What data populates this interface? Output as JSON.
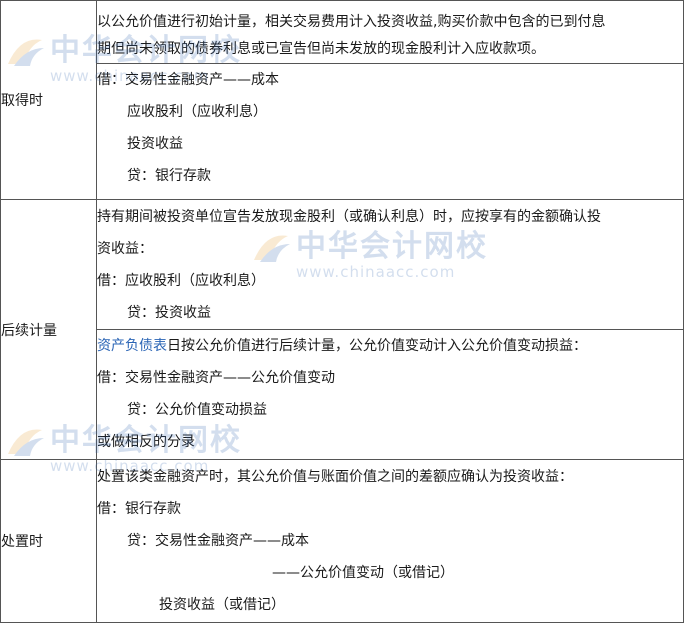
{
  "rows": {
    "acquire": {
      "label": "取得时",
      "lines": [
        "以公允价值进行初始计量，相关交易费用计入投资收益,购买价款中包含的已到付息",
        "期但尚未领取的债券利息或已宣告但尚未发放的现金股利计入应收款项。",
        "借：交易性金融资产——成本",
        "应收股利（应收利息）",
        "投资收益",
        "贷：银行存款"
      ]
    },
    "subsequent": {
      "label": "后续计量",
      "block1": [
        "持有期间被投资单位宣告发放现金股利（或确认利息）时，应按享有的金额确认投",
        "资收益：",
        "借：应收股利（应收利息）",
        "贷：投资收益"
      ],
      "block2_link": "资产负债表",
      "block2_first_rest": "日按公允价值进行后续计量，公允价值变动计入公允价值变动损益：",
      "block2": [
        "借：交易性金融资产——公允价值变动",
        "贷：公允价值变动损益",
        "或做相反的分录"
      ]
    },
    "disposal": {
      "label": "处置时",
      "lines": [
        "处置该类金融资产时，其公允价值与账面价值之间的差额应确认为投资收益：",
        "借：银行存款",
        "贷：交易性金融资产——成本",
        "——公允价值变动（或借记）",
        "投资收益（或借记）"
      ]
    }
  },
  "watermark": {
    "name": "中华会计网校",
    "url": "www.chinaacc.com"
  },
  "colors": {
    "link": "#2a64b5",
    "watermark": "#3d6fb3",
    "border": "#555555"
  }
}
